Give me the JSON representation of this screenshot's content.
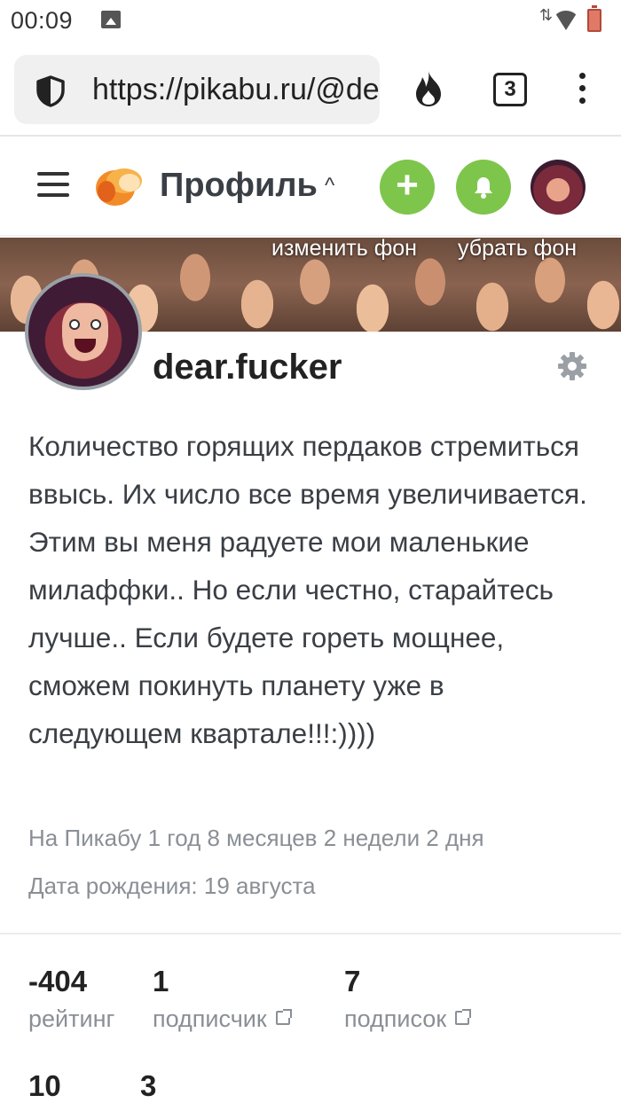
{
  "status_bar": {
    "time": "00:09",
    "icons": [
      "image-icon",
      "signal-arrows-icon",
      "wifi-icon",
      "battery-icon"
    ]
  },
  "browser": {
    "url": "https://pikabu.ru/@dear.fucker",
    "tabs_count": "3",
    "icons": [
      "shield-icon",
      "fire-icon",
      "menu-dots-icon"
    ]
  },
  "header": {
    "title": "Профиль",
    "add_symbol": "+"
  },
  "banner": {
    "change_label": "изменить фон",
    "remove_label": "убрать фон"
  },
  "profile": {
    "username": "dear.fucker",
    "bio": "Количество горящих пердаков стремиться ввысь. Их число все время увеличивается. Этим вы меня радуете мои маленькие милаффки.. Но если честно, старайтесь лучше.. Если будете гореть мощнее, сможем покинуть планету уже в следующем квартале!!!:))))",
    "on_site": "На Пикабу 1 год 8 месяцев 2 недели 2 дня",
    "birthday": "Дата рождения: 19 августа"
  },
  "stats": [
    {
      "value": "-404",
      "label": "рейтинг"
    },
    {
      "value": "1",
      "label": "подписчик"
    },
    {
      "value": "7",
      "label": "подписок"
    },
    {
      "value": "10",
      "label": ""
    },
    {
      "value": "3",
      "label": ""
    }
  ],
  "colors": {
    "accent_green": "#7ec54c",
    "text_muted": "#8a8f96"
  }
}
